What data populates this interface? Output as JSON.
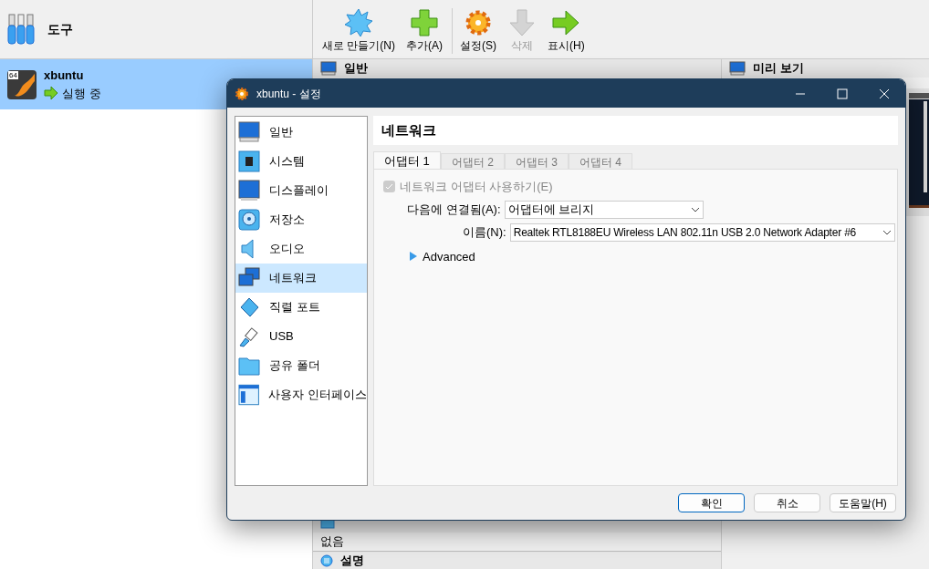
{
  "tools": {
    "label": "도구"
  },
  "vm": {
    "name": "xbuntu",
    "state": "실행 중",
    "badge": "64",
    "selected": true
  },
  "toolbar": [
    {
      "label": "새로 만들기(N)",
      "disabled": false
    },
    {
      "label": "추가(A)",
      "disabled": false
    },
    {
      "label": "설정(S)",
      "disabled": false
    },
    {
      "label": "삭제",
      "disabled": true
    },
    {
      "label": "표시(H)",
      "disabled": false
    }
  ],
  "details": {
    "general": "일반",
    "preview": "미리 보기",
    "shared_value": "없음",
    "description": "설명"
  },
  "dialog": {
    "title": "xbuntu - 설정",
    "sidebar": [
      {
        "label": "일반",
        "selected": false
      },
      {
        "label": "시스템",
        "selected": false
      },
      {
        "label": "디스플레이",
        "selected": false
      },
      {
        "label": "저장소",
        "selected": false
      },
      {
        "label": "오디오",
        "selected": false
      },
      {
        "label": "네트워크",
        "selected": true
      },
      {
        "label": "직렬 포트",
        "selected": false
      },
      {
        "label": "USB",
        "selected": false
      },
      {
        "label": "공유 폴더",
        "selected": false
      },
      {
        "label": "사용자 인터페이스",
        "selected": false
      }
    ],
    "page_title": "네트워크",
    "tabs": [
      {
        "label": "어댑터 1",
        "selected": true
      },
      {
        "label": "어댑터 2",
        "selected": false
      },
      {
        "label": "어댑터 3",
        "selected": false
      },
      {
        "label": "어댑터 4",
        "selected": false
      }
    ],
    "enable": {
      "label": "네트워크 어댑터 사용하기(E)",
      "checked": true,
      "disabled": true
    },
    "attached": {
      "label": "다음에 연결됨(A):",
      "value": "어댑터에 브리지"
    },
    "name": {
      "label": "이름(N):",
      "value": "Realtek RTL8188EU Wireless LAN 802.11n USB 2.0 Network Adapter #6"
    },
    "advanced": {
      "label": "Advanced",
      "expanded": false
    },
    "buttons": [
      {
        "label": "확인",
        "default": true
      },
      {
        "label": "취소",
        "default": false
      },
      {
        "label": "도움말(H)",
        "default": false
      }
    ]
  }
}
